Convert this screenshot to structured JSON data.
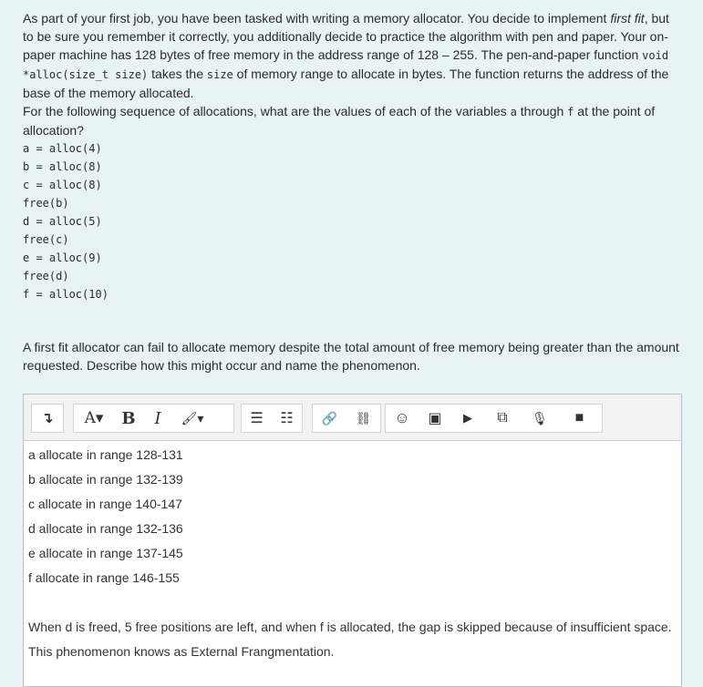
{
  "question1": {
    "p1_a": "As part of your first job, you have been tasked with writing a memory allocator. You decide to implement ",
    "p1_em": "first fit",
    "p1_b": ", but to be sure you remember it correctly, you additionally decide to practice the algorithm with pen and paper. Your on-paper machine has 128 bytes of free memory in the address range of 128 – 255. The pen-and-paper function ",
    "p1_code1": "void *alloc(size_t size)",
    "p1_c": " takes the ",
    "p1_code2": "size",
    "p1_d": " of memory range to allocate in bytes. The function returns the address of the base of the memory allocated.",
    "p2_a": "For the following sequence of allocations, what are the values of each of the variables ",
    "p2_code_a": "a",
    "p2_b": " through ",
    "p2_code_f": "f",
    "p2_c": " at the point of allocation?",
    "code_lines": [
      "a = alloc(4)",
      "b = alloc(8)",
      "c = alloc(8)",
      "free(b)",
      "d = alloc(5)",
      "free(c)",
      "e = alloc(9)",
      "free(d)",
      "f = alloc(10)"
    ]
  },
  "question2": {
    "text": "A first fit allocator can fail to allocate memory despite the total amount of free memory being greater than the amount requested. Describe how this might occur and name the phenomenon."
  },
  "editor": {
    "toolbar": {
      "collapse_icon": "↴",
      "font_size": "A▾",
      "bold": "B",
      "italic": "I",
      "brush": "🖌▾",
      "bullets": "☰",
      "numbered": "☷",
      "link": "🔗",
      "unlink": "⛓",
      "emoji": "☺",
      "image": "▣",
      "media": "▶",
      "manage_files": "⧉",
      "record_audio": "🎙",
      "record_video": "■"
    },
    "answer_lines": [
      "a allocate in range 128-131",
      "b allocate in range 132-139",
      "c allocate in range 140-147",
      "d allocate in range 132-136",
      "e allocate in range 137-145",
      "f allocate in range 146-155"
    ],
    "answer_p2_line1": "When d is freed, 5 free positions are left, and when f is allocated, the gap is skipped because of insufficient space.",
    "answer_p2_line2": "This phenomenon knows as External Frangmentation."
  }
}
